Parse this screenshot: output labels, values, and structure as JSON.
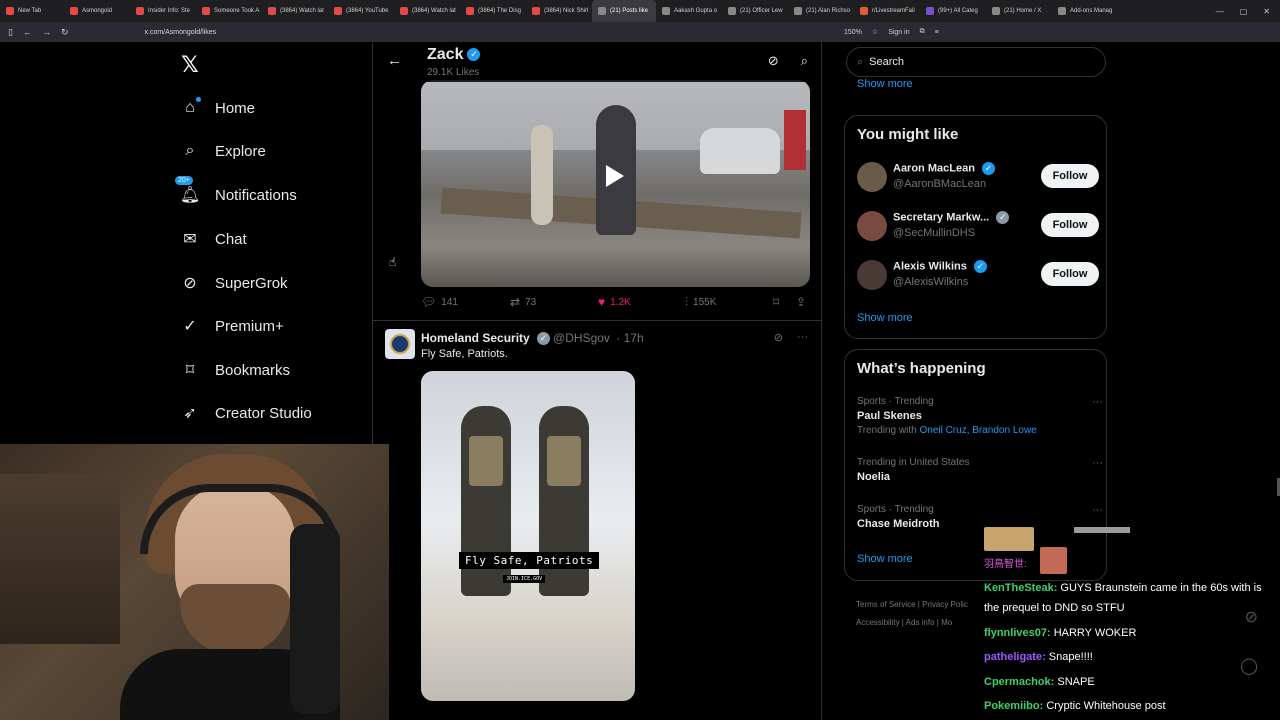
{
  "browser": {
    "tabs": [
      {
        "label": "New Tab",
        "color": "#e04a4a"
      },
      {
        "label": "Asmongold",
        "color": "#e04a4a"
      },
      {
        "label": "Insider Info: Ste",
        "color": "#e04a4a"
      },
      {
        "label": "Someone Took A",
        "color": "#e04a4a"
      },
      {
        "label": "(3864) Watch lat",
        "color": "#e04a4a"
      },
      {
        "label": "(3864) YouTube",
        "color": "#e04a4a"
      },
      {
        "label": "(3864) Watch lat",
        "color": "#e04a4a"
      },
      {
        "label": "(3864) The Disg",
        "color": "#e04a4a"
      },
      {
        "label": "(3864) Nick Shirl",
        "color": "#e04a4a"
      },
      {
        "label": "(21) Posts like",
        "color": "#888888",
        "active": true
      },
      {
        "label": "Aakash Gupta o",
        "color": "#888888"
      },
      {
        "label": "(21) Officer Lew",
        "color": "#888888"
      },
      {
        "label": "(21) Alan Richso",
        "color": "#888888"
      },
      {
        "label": "r/LivestreamFail",
        "color": "#e06030"
      },
      {
        "label": "(99+) All Categ",
        "color": "#7a4fd0"
      },
      {
        "label": "(21) Home / X",
        "color": "#888888"
      },
      {
        "label": "Add-ons Manag",
        "color": "#888888"
      }
    ],
    "url": "x.com/Asmongold/likes",
    "zoom": "150%",
    "sign_in": "Sign in"
  },
  "leftnav": {
    "items": [
      {
        "label": "Home",
        "icon": "home-icon"
      },
      {
        "label": "Explore",
        "icon": "search-icon"
      },
      {
        "label": "Notifications",
        "icon": "bell-icon",
        "badge": "20+"
      },
      {
        "label": "Chat",
        "icon": "mail-icon"
      },
      {
        "label": "SuperGrok",
        "icon": "grok-icon"
      },
      {
        "label": "Premium+",
        "icon": "verified-icon"
      },
      {
        "label": "Bookmarks",
        "icon": "bookmark-icon"
      },
      {
        "label": "Creator Studio",
        "icon": "rocket-icon"
      }
    ]
  },
  "header": {
    "name": "Zack",
    "likes": "29.1K Likes"
  },
  "post1": {
    "stats": {
      "replies": "141",
      "reposts": "73",
      "likes": "1.2K",
      "views": "155K"
    }
  },
  "post2": {
    "author": "Homeland Security",
    "handle": "@DHSgov",
    "time": "· 17h",
    "text": "Fly Safe, Patriots.",
    "caption": "Fly Safe, Patriots",
    "caption_sub": "JOIN.ICE.GOV"
  },
  "sidebar": {
    "search_placeholder": "Search",
    "show_more_top": "Show more",
    "who_title": "You might like",
    "who": [
      {
        "name": "Aaron MacLean",
        "handle": "@AaronBMacLean",
        "follow": "Follow"
      },
      {
        "name": "Secretary Markw...",
        "handle": "@SecMullinDHS",
        "follow": "Follow"
      },
      {
        "name": "Alexis Wilkins",
        "handle": "@AlexisWilkins",
        "follow": "Follow"
      }
    ],
    "who_show_more": "Show more",
    "happening_title": "What’s happening",
    "trends": [
      {
        "category": "Sports · Trending",
        "name": "Paul Skenes",
        "with_prefix": "Trending with",
        "with": "Oneil Cruz, Brandon Lowe"
      },
      {
        "category": "Trending in United States",
        "name": "Noelia"
      },
      {
        "category": "Sports · Trending",
        "name": "Chase Meidroth"
      }
    ],
    "happening_show_more": "Show more",
    "footer_line1": "Terms of Service  |  Privacy Polic",
    "footer_line2": "Accessibility  |  Ads info  |  Mo"
  },
  "chat": {
    "top_label": "羽鳥智世:",
    "messages": [
      {
        "user": "KenTheSteak:",
        "text": "GUYS Braunstein came in the 60s with is the prequel to DND so STFU",
        "color": "#3ed06b"
      },
      {
        "user": "flynnlives07:",
        "text": "HARRY WOKER",
        "color": "#3ed06b"
      },
      {
        "user": "patheligate:",
        "text": "Snape!!!!",
        "color": "#9b59ff"
      },
      {
        "user": "Cpermachok:",
        "text": "SNAPE",
        "color": "#3ed06b"
      },
      {
        "user": "Pokemiibo:",
        "text": "Cryptic Whitehouse post",
        "color": "#3ed06b"
      }
    ]
  }
}
